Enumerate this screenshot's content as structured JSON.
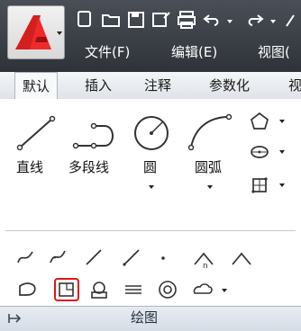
{
  "app": {
    "menu": [
      "文件(F)",
      "编辑(E)",
      "视图("
    ],
    "tabs": [
      "默认",
      "插入",
      "注释",
      "参数化",
      "视"
    ],
    "active_tab": "默认",
    "tools": {
      "line": "直线",
      "polyline": "多段线",
      "circle": "圆",
      "arc": "圆弧"
    },
    "panel_title": "绘图",
    "accent": "#d41f1f",
    "selected_outline": "#e01616"
  }
}
